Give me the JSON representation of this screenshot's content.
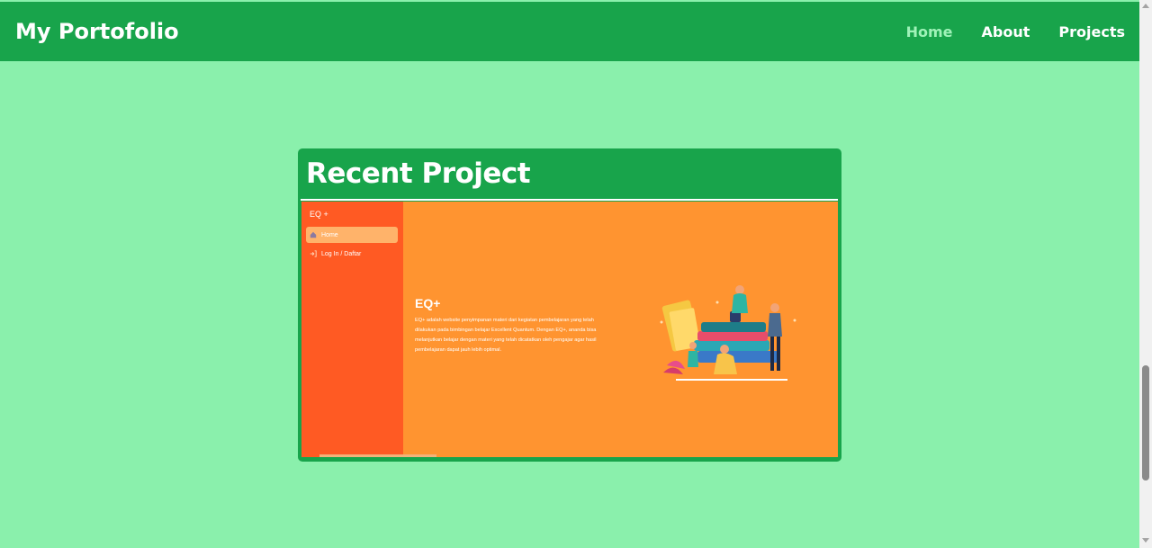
{
  "navbar": {
    "brand": "My Portofolio",
    "links": [
      "Home",
      "About",
      "Projects"
    ],
    "active_link": "Home",
    "colors": {
      "bar": "#18a44b",
      "active": "#9ff2b8",
      "text": "#ffffff"
    }
  },
  "page": {
    "background": "#8af0ac"
  },
  "card": {
    "title": "Recent Project",
    "screenshot": {
      "sidebar": {
        "brand": "EQ +",
        "items": [
          {
            "label": "Home",
            "icon": "home-icon",
            "selected": true
          },
          {
            "label": "Log In / Daftar",
            "icon": "login-icon",
            "selected": false
          }
        ]
      },
      "heading": "EQ+",
      "description": "EQ+ adalah website penyimpanan materi dari kegiatan pembelajaran yang telah dilakukan pada bimbingan belajar Excellent Quantum. Dengan EQ+, ananda bisa melanjutkan belajar dengan materi yang telah dicatatkan oleh pengajar agar hasil pembelajaran dapat jauh lebih optimal.",
      "illustration": "students-with-books-illustration",
      "colors": {
        "sidebar": "#ff5a23",
        "main": "#ff9430"
      }
    }
  }
}
